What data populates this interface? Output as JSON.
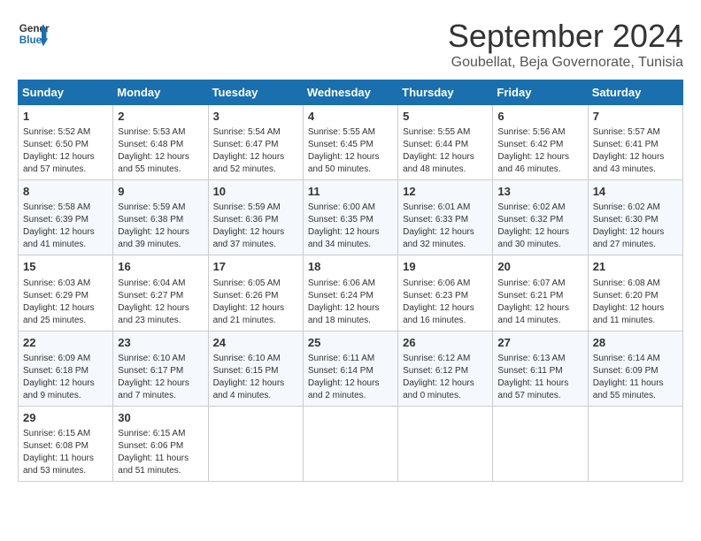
{
  "header": {
    "logo_line1": "General",
    "logo_line2": "Blue",
    "month": "September 2024",
    "location": "Goubellat, Beja Governorate, Tunisia"
  },
  "weekdays": [
    "Sunday",
    "Monday",
    "Tuesday",
    "Wednesday",
    "Thursday",
    "Friday",
    "Saturday"
  ],
  "weeks": [
    [
      {
        "day": "1",
        "info": "Sunrise: 5:52 AM\nSunset: 6:50 PM\nDaylight: 12 hours and 57 minutes."
      },
      {
        "day": "2",
        "info": "Sunrise: 5:53 AM\nSunset: 6:48 PM\nDaylight: 12 hours and 55 minutes."
      },
      {
        "day": "3",
        "info": "Sunrise: 5:54 AM\nSunset: 6:47 PM\nDaylight: 12 hours and 52 minutes."
      },
      {
        "day": "4",
        "info": "Sunrise: 5:55 AM\nSunset: 6:45 PM\nDaylight: 12 hours and 50 minutes."
      },
      {
        "day": "5",
        "info": "Sunrise: 5:55 AM\nSunset: 6:44 PM\nDaylight: 12 hours and 48 minutes."
      },
      {
        "day": "6",
        "info": "Sunrise: 5:56 AM\nSunset: 6:42 PM\nDaylight: 12 hours and 46 minutes."
      },
      {
        "day": "7",
        "info": "Sunrise: 5:57 AM\nSunset: 6:41 PM\nDaylight: 12 hours and 43 minutes."
      }
    ],
    [
      {
        "day": "8",
        "info": "Sunrise: 5:58 AM\nSunset: 6:39 PM\nDaylight: 12 hours and 41 minutes."
      },
      {
        "day": "9",
        "info": "Sunrise: 5:59 AM\nSunset: 6:38 PM\nDaylight: 12 hours and 39 minutes."
      },
      {
        "day": "10",
        "info": "Sunrise: 5:59 AM\nSunset: 6:36 PM\nDaylight: 12 hours and 37 minutes."
      },
      {
        "day": "11",
        "info": "Sunrise: 6:00 AM\nSunset: 6:35 PM\nDaylight: 12 hours and 34 minutes."
      },
      {
        "day": "12",
        "info": "Sunrise: 6:01 AM\nSunset: 6:33 PM\nDaylight: 12 hours and 32 minutes."
      },
      {
        "day": "13",
        "info": "Sunrise: 6:02 AM\nSunset: 6:32 PM\nDaylight: 12 hours and 30 minutes."
      },
      {
        "day": "14",
        "info": "Sunrise: 6:02 AM\nSunset: 6:30 PM\nDaylight: 12 hours and 27 minutes."
      }
    ],
    [
      {
        "day": "15",
        "info": "Sunrise: 6:03 AM\nSunset: 6:29 PM\nDaylight: 12 hours and 25 minutes."
      },
      {
        "day": "16",
        "info": "Sunrise: 6:04 AM\nSunset: 6:27 PM\nDaylight: 12 hours and 23 minutes."
      },
      {
        "day": "17",
        "info": "Sunrise: 6:05 AM\nSunset: 6:26 PM\nDaylight: 12 hours and 21 minutes."
      },
      {
        "day": "18",
        "info": "Sunrise: 6:06 AM\nSunset: 6:24 PM\nDaylight: 12 hours and 18 minutes."
      },
      {
        "day": "19",
        "info": "Sunrise: 6:06 AM\nSunset: 6:23 PM\nDaylight: 12 hours and 16 minutes."
      },
      {
        "day": "20",
        "info": "Sunrise: 6:07 AM\nSunset: 6:21 PM\nDaylight: 12 hours and 14 minutes."
      },
      {
        "day": "21",
        "info": "Sunrise: 6:08 AM\nSunset: 6:20 PM\nDaylight: 12 hours and 11 minutes."
      }
    ],
    [
      {
        "day": "22",
        "info": "Sunrise: 6:09 AM\nSunset: 6:18 PM\nDaylight: 12 hours and 9 minutes."
      },
      {
        "day": "23",
        "info": "Sunrise: 6:10 AM\nSunset: 6:17 PM\nDaylight: 12 hours and 7 minutes."
      },
      {
        "day": "24",
        "info": "Sunrise: 6:10 AM\nSunset: 6:15 PM\nDaylight: 12 hours and 4 minutes."
      },
      {
        "day": "25",
        "info": "Sunrise: 6:11 AM\nSunset: 6:14 PM\nDaylight: 12 hours and 2 minutes."
      },
      {
        "day": "26",
        "info": "Sunrise: 6:12 AM\nSunset: 6:12 PM\nDaylight: 12 hours and 0 minutes."
      },
      {
        "day": "27",
        "info": "Sunrise: 6:13 AM\nSunset: 6:11 PM\nDaylight: 11 hours and 57 minutes."
      },
      {
        "day": "28",
        "info": "Sunrise: 6:14 AM\nSunset: 6:09 PM\nDaylight: 11 hours and 55 minutes."
      }
    ],
    [
      {
        "day": "29",
        "info": "Sunrise: 6:15 AM\nSunset: 6:08 PM\nDaylight: 11 hours and 53 minutes."
      },
      {
        "day": "30",
        "info": "Sunrise: 6:15 AM\nSunset: 6:06 PM\nDaylight: 11 hours and 51 minutes."
      },
      {
        "day": "",
        "info": ""
      },
      {
        "day": "",
        "info": ""
      },
      {
        "day": "",
        "info": ""
      },
      {
        "day": "",
        "info": ""
      },
      {
        "day": "",
        "info": ""
      }
    ]
  ]
}
